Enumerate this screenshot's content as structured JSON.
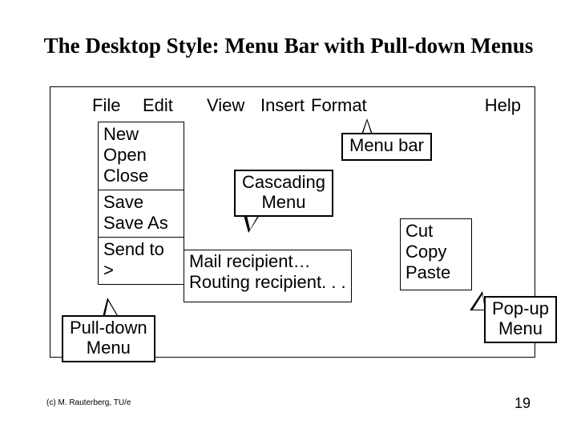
{
  "title": "The Desktop Style: Menu Bar with Pull-down Menus",
  "menubar": {
    "file": "File",
    "edit": "Edit",
    "view": "View",
    "insert": "Insert",
    "format": "Format",
    "help": "Help"
  },
  "pulldown": {
    "group1": {
      "new": "New",
      "open": "Open",
      "close": "Close"
    },
    "group2": {
      "save": "Save",
      "saveas": "Save As"
    },
    "group3": {
      "sendto": "Send to >"
    }
  },
  "cascade": {
    "mail": "Mail recipient…",
    "routing": "Routing recipient. . ."
  },
  "popup": {
    "cut": "Cut",
    "copy": "Copy",
    "paste": "Paste"
  },
  "callouts": {
    "menubar": "Menu bar",
    "cascading": "Cascading\nMenu",
    "pulldown": "Pull-down\nMenu",
    "popup": "Pop-up\nMenu"
  },
  "footer": {
    "copyright": "(c) M. Rauterberg, TU/e",
    "page": "19"
  }
}
